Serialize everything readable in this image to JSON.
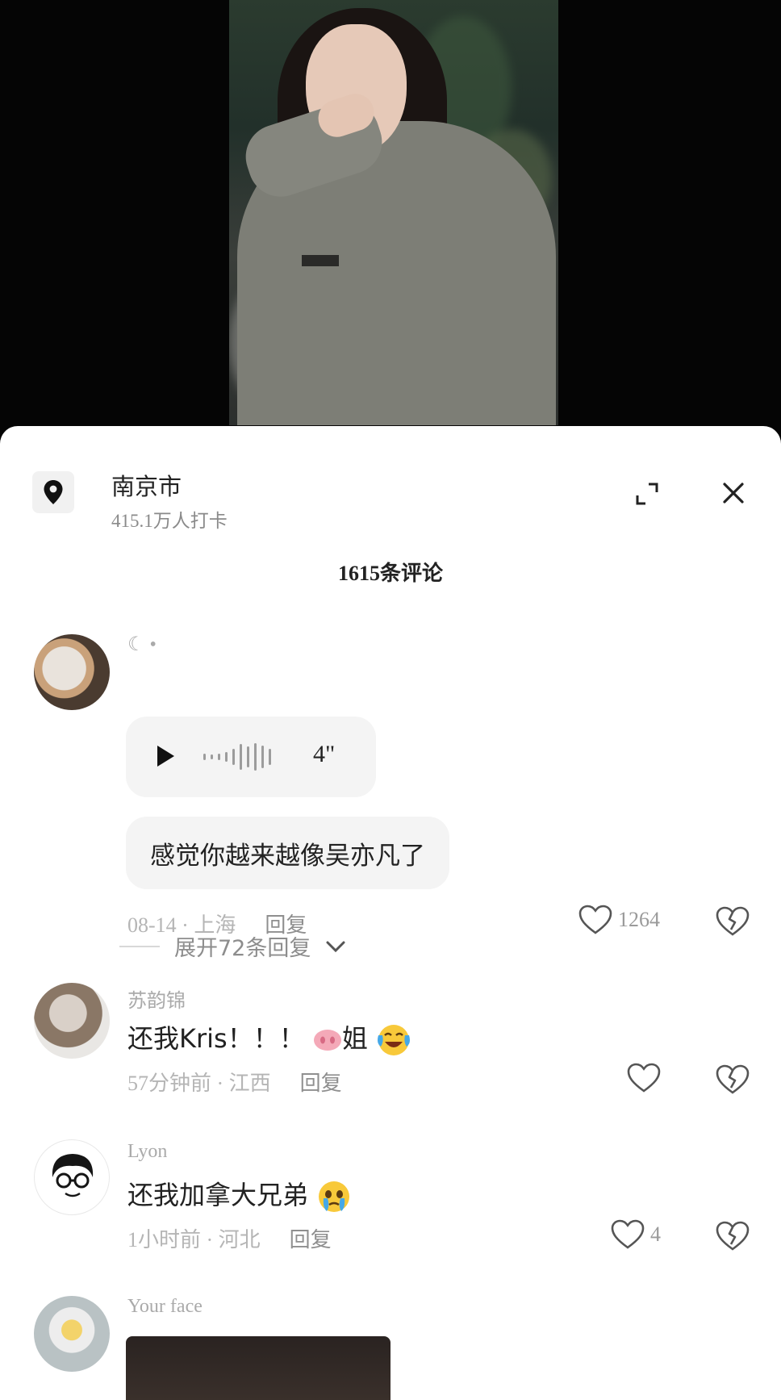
{
  "location": {
    "name": "南京市",
    "checkins": "415.1万人打卡"
  },
  "comments_header": {
    "title": "1615条评论"
  },
  "comments": [
    {
      "username": "☾ •",
      "voice_duration": "4\"",
      "text": "感觉你越来越像吴亦凡了",
      "date_location": "08-14 · 上海",
      "reply_label": "回复",
      "likes": "1264",
      "expand_replies": "展开72条回复"
    },
    {
      "username": "苏韵锦",
      "text": "还我Kris！！！",
      "text_suffix": "姐",
      "date_location": "57分钟前 · 江西",
      "reply_label": "回复",
      "likes": ""
    },
    {
      "username": "Lyon",
      "text": "还我加拿大兄弟",
      "date_location": "1小时前 · 河北",
      "reply_label": "回复",
      "likes": "4"
    },
    {
      "username": "Your face"
    }
  ],
  "icons": {
    "location": "location-pin-icon",
    "expand": "expand-icon",
    "close": "close-icon",
    "play": "play-icon",
    "like": "heart-outline-icon",
    "dislike": "broken-heart-icon"
  }
}
